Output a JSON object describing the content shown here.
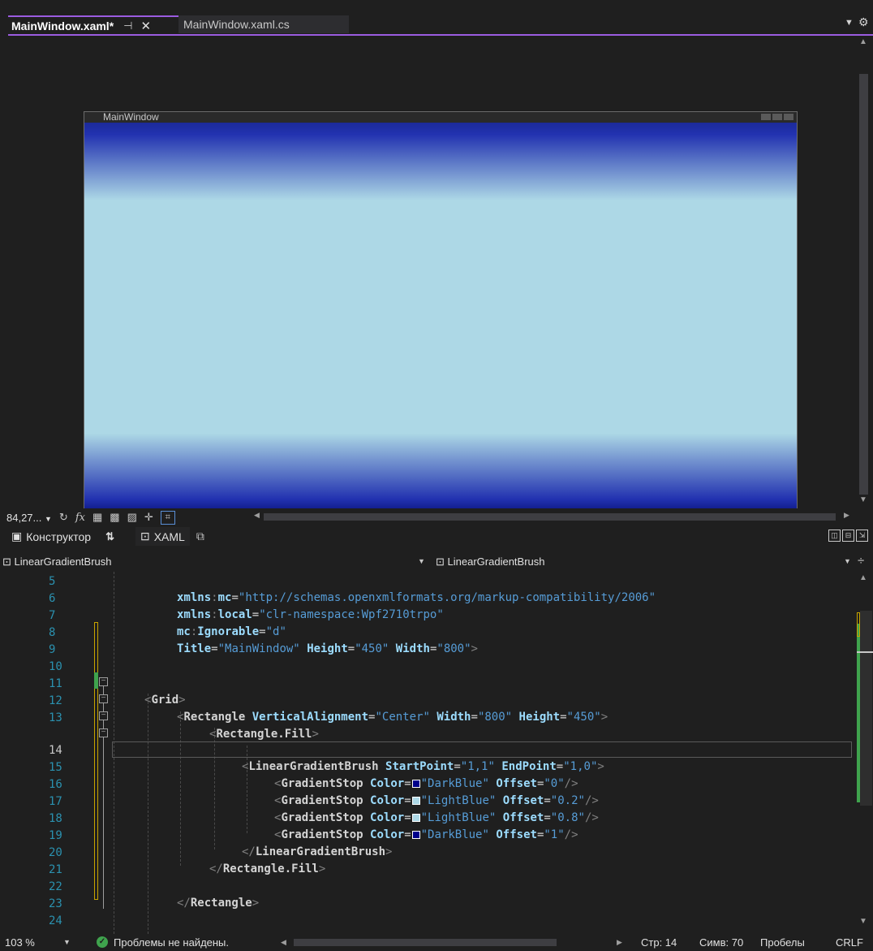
{
  "tabs": {
    "active": {
      "label": "MainWindow.xaml*",
      "pin_icon": "pin-icon",
      "close_icon": "close-icon"
    },
    "inactive": {
      "label": "MainWindow.xaml.cs"
    }
  },
  "designer": {
    "window_title": "MainWindow",
    "gradient_colors": {
      "dark": "#00008B",
      "light": "#ADD8E6"
    }
  },
  "designer_toolbar": {
    "zoom": "84,27...",
    "icons": [
      "refresh-icon",
      "fx-icon",
      "grid-icon",
      "snap-grid-icon",
      "checker-icon",
      "snap-lines-icon",
      "select-icon"
    ]
  },
  "split_bar": {
    "constructor_label": "Конструктор",
    "swap_label": "⇅",
    "xaml_label": "XAML"
  },
  "nav_bar": {
    "left": "LinearGradientBrush",
    "right": "LinearGradientBrush"
  },
  "code_lines": [
    {
      "n": "5"
    },
    {
      "n": "6"
    },
    {
      "n": "7"
    },
    {
      "n": "8"
    },
    {
      "n": "9"
    },
    {
      "n": "10"
    },
    {
      "n": "11"
    },
    {
      "n": "12"
    },
    {
      "n": "13"
    },
    {
      "n": "14"
    },
    {
      "n": "15"
    },
    {
      "n": "16"
    },
    {
      "n": "17"
    },
    {
      "n": "18"
    },
    {
      "n": "19"
    },
    {
      "n": "20"
    },
    {
      "n": "21"
    },
    {
      "n": "22"
    },
    {
      "n": "23"
    },
    {
      "n": "24"
    }
  ],
  "code": {
    "l5": {
      "ns": "xmlns",
      "sep": ":",
      "attr": "mc",
      "eq": "=",
      "val": "\"http://schemas.openxmlformats.org/markup-compatibility/2006\""
    },
    "l6": {
      "ns": "xmlns",
      "sep": ":",
      "attr": "local",
      "eq": "=",
      "val": "\"clr-namespace:Wpf2710trpo\""
    },
    "l7": {
      "ns": "mc",
      "sep": ":",
      "attr": "Ignorable",
      "eq": "=",
      "val": "\"d\""
    },
    "l8": {
      "a1": "Title",
      "v1": "\"MainWindow\"",
      "a2": "Height",
      "v2": "\"450\"",
      "a3": "Width",
      "v3": "\"800\"",
      "end": ">"
    },
    "l11": {
      "open": "<",
      "el": "Grid",
      "close": ">"
    },
    "l12": {
      "open": "<",
      "el": "Rectangle",
      "a1": "VerticalAlignment",
      "v1": "\"Center\"",
      "a2": "Width",
      "v2": "\"800\"",
      "a3": "Height",
      "v3": "\"450\"",
      "close": ">"
    },
    "l13": {
      "open": "<",
      "el": "Rectangle.Fill",
      "close": ">"
    },
    "l14": {
      "open": "<",
      "el": "LinearGradientBrush",
      "a1": "StartPoint",
      "v1": "\"1,1\"",
      "a2": "EndPoint",
      "v2": "\"1,0\"",
      "close": ">"
    },
    "l15": {
      "open": "<",
      "el": "GradientStop",
      "a1": "Color",
      "v1": "\"DarkBlue\"",
      "a2": "Offset",
      "v2": "\"0\"",
      "close": "/>",
      "swatch": "#00008B"
    },
    "l16": {
      "open": "<",
      "el": "GradientStop",
      "a1": "Color",
      "v1": "\"LightBlue\"",
      "a2": "Offset",
      "v2": "\"0.2\"",
      "close": "/>",
      "swatch": "#ADD8E6"
    },
    "l17": {
      "open": "<",
      "el": "GradientStop",
      "a1": "Color",
      "v1": "\"LightBlue\"",
      "a2": "Offset",
      "v2": "\"0.8\"",
      "close": "/>",
      "swatch": "#ADD8E6"
    },
    "l18": {
      "open": "<",
      "el": "GradientStop",
      "a1": "Color",
      "v1": "\"DarkBlue\"",
      "a2": "Offset",
      "v2": "\"1\"",
      "close": "/>",
      "swatch": "#00008B"
    },
    "l19": {
      "open": "</",
      "el": "LinearGradientBrush",
      "close": ">"
    },
    "l20": {
      "open": "</",
      "el": "Rectangle.Fill",
      "close": ">"
    },
    "l22": {
      "open": "</",
      "el": "Rectangle",
      "close": ">"
    }
  },
  "status_bar": {
    "zoom": "103 %",
    "issues": "Проблемы не найдены.",
    "line": "Стр: 14",
    "col": "Симв: 70",
    "spaces": "Пробелы",
    "eol": "CRLF"
  }
}
